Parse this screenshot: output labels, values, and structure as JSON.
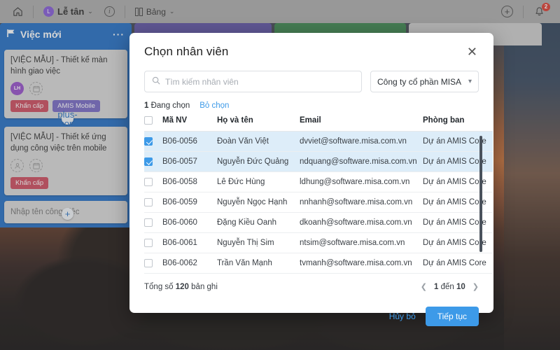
{
  "toolbar": {
    "home_icon": "home-icon",
    "app_name": "Lễ tân",
    "app_badge_letter": "L",
    "info_icon": "info-icon",
    "view_icon": "grid-view-icon",
    "view_label": "Bảng",
    "add_icon": "plus-circle-icon",
    "bell_icon": "bell-icon",
    "notification_count": "2",
    "caret": "⌄"
  },
  "board": {
    "columns": [
      {
        "title": "Việc mới",
        "flag_icon": "flag-icon",
        "menu": "···",
        "color": "#1565c0"
      },
      {
        "title": "",
        "color": "#54489e"
      },
      {
        "title": "",
        "color": "#2e7d43"
      },
      {
        "title": "",
        "color": "#c9c9c9"
      }
    ],
    "cards": [
      {
        "title": "[VIỆC MẪU] - Thiết kế màn hình giao việc",
        "avatar_initials": "LH",
        "calendar_icon": "calendar-icon",
        "tags": [
          {
            "label": "Khẩn cấp",
            "color": "#c94054"
          },
          {
            "label": "AMIS Mobile",
            "color": "#6e5fc0"
          }
        ]
      },
      {
        "title": "[VIỆC MẪU] - Thiết kế ứng dụng công việc trên mobile",
        "avatar_icon": "person-icon",
        "calendar_icon": "calendar-icon",
        "tags": [
          {
            "label": "Khẩn cấp",
            "color": "#c94054"
          }
        ]
      }
    ],
    "new_task_placeholder": "Nhập tên công việc",
    "add_card_icon": "plus-icon"
  },
  "modal": {
    "title": "Chọn nhân viên",
    "close_icon": "close-icon",
    "search": {
      "icon": "search-icon",
      "placeholder": "Tìm kiếm nhân viên",
      "value": ""
    },
    "company_select": {
      "value": "Công ty cổ phần MISA",
      "caret_icon": "chevron-down-icon"
    },
    "selection": {
      "count": "1",
      "count_label": "Đang chọn",
      "clear_label": "Bỏ chọn"
    },
    "table": {
      "headers": [
        "Mã NV",
        "Họ và tên",
        "Email",
        "Phòng ban"
      ],
      "header_checkbox_checked": false,
      "rows": [
        {
          "checked": true,
          "code": "B06-0056",
          "name": "Đoàn Văn Việt",
          "email": "dvviet@software.misa.com.vn",
          "dept": "Dự án AMIS Core"
        },
        {
          "checked": true,
          "code": "B06-0057",
          "name": "Nguyễn Đức Quảng",
          "email": "ndquang@software.misa.com.vn",
          "dept": "Dự án AMIS Core"
        },
        {
          "checked": false,
          "code": "B06-0058",
          "name": "Lê Đức Hùng",
          "email": "ldhung@software.misa.com.vn",
          "dept": "Dự án AMIS Core"
        },
        {
          "checked": false,
          "code": "B06-0059",
          "name": "Nguyễn Ngọc Hạnh",
          "email": "nnhanh@software.misa.com.vn",
          "dept": "Dự án AMIS Core"
        },
        {
          "checked": false,
          "code": "B06-0060",
          "name": "Đặng Kiều Oanh",
          "email": "dkoanh@software.misa.com.vn",
          "dept": "Dự án AMIS Core"
        },
        {
          "checked": false,
          "code": "B06-0061",
          "name": "Nguyễn Thị Sim",
          "email": "ntsim@software.misa.com.vn",
          "dept": "Dự án AMIS Core"
        },
        {
          "checked": false,
          "code": "B06-0062",
          "name": "Trần Văn Mạnh",
          "email": "tvmanh@software.misa.com.vn",
          "dept": "Dự án AMIS Core"
        }
      ]
    },
    "footer": {
      "total_prefix": "Tổng số",
      "total_count": "120",
      "total_suffix": "bản ghi",
      "page_prev_icon": "chevron-left-icon",
      "page_next_icon": "chevron-right-icon",
      "page_from": "1",
      "page_mid": "đến",
      "page_to": "10",
      "cancel_label": "Hủy bỏ",
      "continue_label": "Tiếp tục"
    }
  },
  "colors": {
    "primary": "#3d9ae8",
    "selected_row": "#ddedf9",
    "badge_red": "#d93025",
    "col_blue": "#1565c0",
    "col_purple": "#54489e",
    "col_green": "#2e7d43"
  }
}
